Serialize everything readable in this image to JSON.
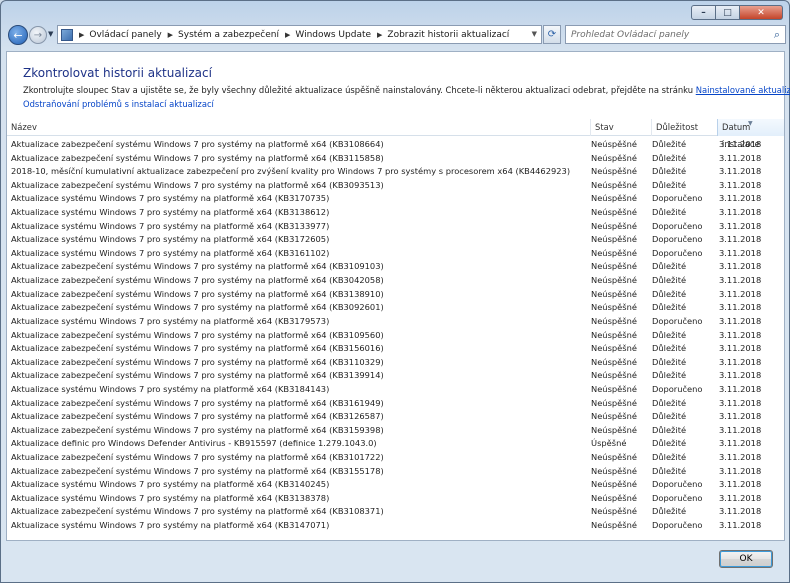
{
  "window": {
    "caption_buttons": {
      "min": "–",
      "max": "□",
      "close": "✕"
    }
  },
  "nav": {
    "back_icon": "←",
    "forward_icon": "→",
    "breadcrumbs": [
      "Ovládací panely",
      "Systém a zabezpečení",
      "Windows Update",
      "Zobrazit historii aktualizací"
    ],
    "refresh_icon": "⟳",
    "search_placeholder": "Prohledat Ovládací panely",
    "search_icon": "⌕"
  },
  "page": {
    "title": "Zkontrolovat historii aktualizací",
    "description_prefix": "Zkontrolujte sloupec Stav a ujistěte se, že byly všechny důležité aktualizace úspěšně nainstalovány. Chcete-li některou aktualizaci odebrat, přejděte na stránku ",
    "description_link": "Nainstalované aktualizace",
    "description_suffix": ".",
    "troubleshoot_link": "Odstraňování problémů s instalací aktualizací"
  },
  "table": {
    "columns": [
      "Název",
      "Stav",
      "Důležitost",
      "Datum instalace"
    ],
    "rows": [
      [
        "Aktualizace zabezpečení systému Windows 7 pro systémy na platformě x64 (KB3108664)",
        "Neúspěšné",
        "Důležité",
        "3.11.2018"
      ],
      [
        "Aktualizace zabezpečení systému Windows 7 pro systémy na platformě x64 (KB3115858)",
        "Neúspěšné",
        "Důležité",
        "3.11.2018"
      ],
      [
        "2018-10, měsíční kumulativní aktualizace zabezpečení pro zvýšení kvality pro Windows 7 pro systémy s procesorem x64 (KB4462923)",
        "Neúspěšné",
        "Důležité",
        "3.11.2018"
      ],
      [
        "Aktualizace zabezpečení systému Windows 7 pro systémy na platformě x64 (KB3093513)",
        "Neúspěšné",
        "Důležité",
        "3.11.2018"
      ],
      [
        "Aktualizace systému Windows 7 pro systémy na platformě x64 (KB3170735)",
        "Neúspěšné",
        "Doporučeno",
        "3.11.2018"
      ],
      [
        "Aktualizace systému Windows 7 pro systémy na platformě x64 (KB3138612)",
        "Neúspěšné",
        "Důležité",
        "3.11.2018"
      ],
      [
        "Aktualizace systému Windows 7 pro systémy na platformě x64 (KB3133977)",
        "Neúspěšné",
        "Doporučeno",
        "3.11.2018"
      ],
      [
        "Aktualizace systému Windows 7 pro systémy na platformě x64 (KB3172605)",
        "Neúspěšné",
        "Doporučeno",
        "3.11.2018"
      ],
      [
        "Aktualizace systému Windows 7 pro systémy na platformě x64 (KB3161102)",
        "Neúspěšné",
        "Doporučeno",
        "3.11.2018"
      ],
      [
        "Aktualizace zabezpečení systému Windows 7 pro systémy na platformě x64 (KB3109103)",
        "Neúspěšné",
        "Důležité",
        "3.11.2018"
      ],
      [
        "Aktualizace zabezpečení systému Windows 7 pro systémy na platformě x64 (KB3042058)",
        "Neúspěšné",
        "Důležité",
        "3.11.2018"
      ],
      [
        "Aktualizace zabezpečení systému Windows 7 pro systémy na platformě x64 (KB3138910)",
        "Neúspěšné",
        "Důležité",
        "3.11.2018"
      ],
      [
        "Aktualizace zabezpečení systému Windows 7 pro systémy na platformě x64 (KB3092601)",
        "Neúspěšné",
        "Důležité",
        "3.11.2018"
      ],
      [
        "Aktualizace systému Windows 7 pro systémy na platformě x64 (KB3179573)",
        "Neúspěšné",
        "Doporučeno",
        "3.11.2018"
      ],
      [
        "Aktualizace zabezpečení systému Windows 7 pro systémy na platformě x64 (KB3109560)",
        "Neúspěšné",
        "Důležité",
        "3.11.2018"
      ],
      [
        "Aktualizace zabezpečení systému Windows 7 pro systémy na platformě x64 (KB3156016)",
        "Neúspěšné",
        "Důležité",
        "3.11.2018"
      ],
      [
        "Aktualizace zabezpečení systému Windows 7 pro systémy na platformě x64 (KB3110329)",
        "Neúspěšné",
        "Důležité",
        "3.11.2018"
      ],
      [
        "Aktualizace zabezpečení systému Windows 7 pro systémy na platformě x64 (KB3139914)",
        "Neúspěšné",
        "Důležité",
        "3.11.2018"
      ],
      [
        "Aktualizace systému Windows 7 pro systémy na platformě x64 (KB3184143)",
        "Neúspěšné",
        "Doporučeno",
        "3.11.2018"
      ],
      [
        "Aktualizace zabezpečení systému Windows 7 pro systémy na platformě x64 (KB3161949)",
        "Neúspěšné",
        "Důležité",
        "3.11.2018"
      ],
      [
        "Aktualizace zabezpečení systému Windows 7 pro systémy na platformě x64 (KB3126587)",
        "Neúspěšné",
        "Důležité",
        "3.11.2018"
      ],
      [
        "Aktualizace zabezpečení systému Windows 7 pro systémy na platformě x64 (KB3159398)",
        "Neúspěšné",
        "Důležité",
        "3.11.2018"
      ],
      [
        "Aktualizace definic pro Windows Defender Antivirus - KB915597 (definice 1.279.1043.0)",
        "Úspěšné",
        "Důležité",
        "3.11.2018"
      ],
      [
        "Aktualizace zabezpečení systému Windows 7 pro systémy na platformě x64 (KB3101722)",
        "Neúspěšné",
        "Důležité",
        "3.11.2018"
      ],
      [
        "Aktualizace zabezpečení systému Windows 7 pro systémy na platformě x64 (KB3155178)",
        "Neúspěšné",
        "Důležité",
        "3.11.2018"
      ],
      [
        "Aktualizace systému Windows 7 pro systémy na platformě x64 (KB3140245)",
        "Neúspěšné",
        "Doporučeno",
        "3.11.2018"
      ],
      [
        "Aktualizace systému Windows 7 pro systémy na platformě x64 (KB3138378)",
        "Neúspěšné",
        "Doporučeno",
        "3.11.2018"
      ],
      [
        "Aktualizace zabezpečení systému Windows 7 pro systémy na platformě x64 (KB3108371)",
        "Neúspěšné",
        "Důležité",
        "3.11.2018"
      ],
      [
        "Aktualizace systému Windows 7 pro systémy na platformě x64 (KB3147071)",
        "Neúspěšné",
        "Doporučeno",
        "3.11.2018"
      ]
    ]
  },
  "footer": {
    "ok_label": "OK"
  }
}
